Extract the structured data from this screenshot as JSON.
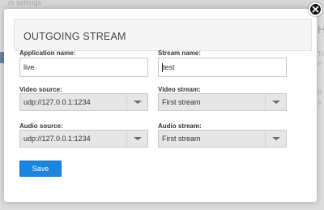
{
  "background": {
    "breadcrumb": "rs settings",
    "right_title": "H",
    "right_line_1": "Tr",
    "right_line_2": "e",
    "right_line_3": "R",
    "right_line_4": "a"
  },
  "modal": {
    "title": "OUTGOING STREAM",
    "fields": {
      "application_name": {
        "label": "Application name:",
        "value": "live"
      },
      "stream_name": {
        "label": "Stream name:",
        "value": "test"
      },
      "video_source": {
        "label": "Video source:",
        "value": "udp://127.0.0.1:1234"
      },
      "video_stream": {
        "label": "Video stream:",
        "value": "First stream"
      },
      "audio_source": {
        "label": "Audio source:",
        "value": "udp://127.0.0.1:1234"
      },
      "audio_stream": {
        "label": "Audio stream:",
        "value": "First stream"
      }
    },
    "save_label": "Save",
    "close_icon": "close-icon"
  },
  "colors": {
    "accent": "#1a86e0",
    "close_button": "#111111"
  }
}
